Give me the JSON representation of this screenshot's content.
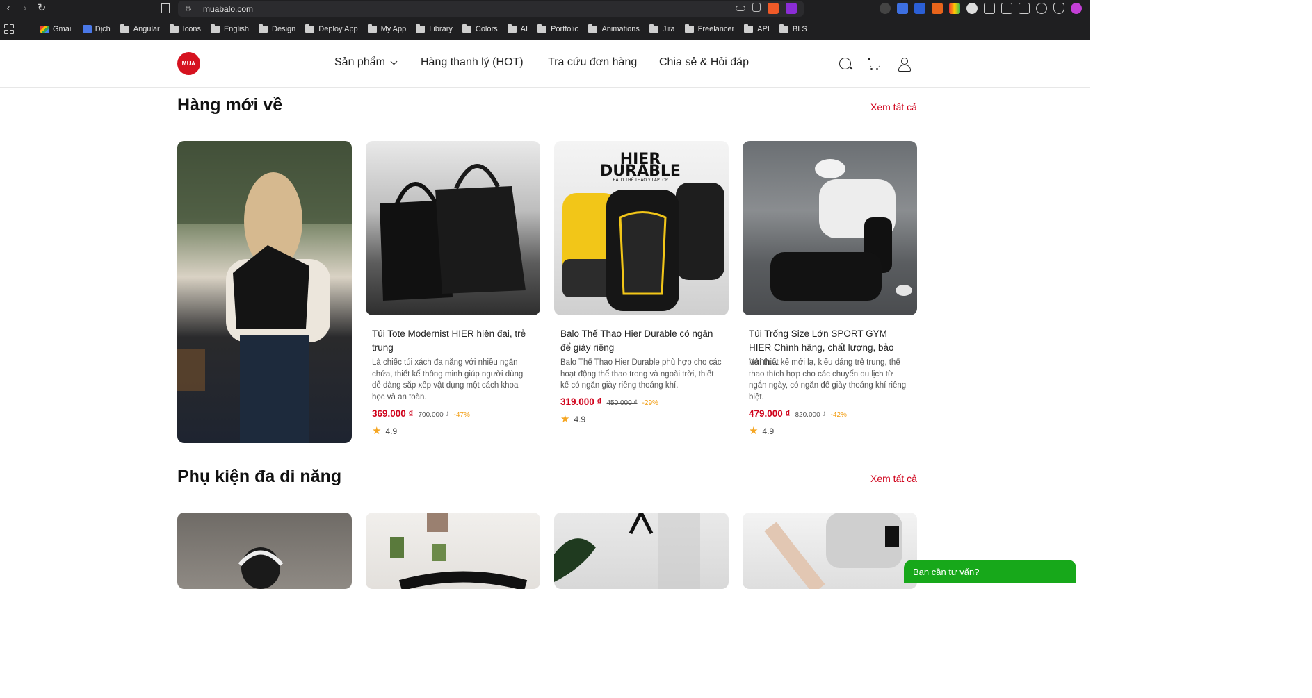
{
  "browser": {
    "url": "muabalo.com",
    "bookmarks": [
      "Gmail",
      "Dịch",
      "Angular",
      "Icons",
      "English",
      "Design",
      "Deploy App",
      "My App",
      "Library",
      "Colors",
      "AI",
      "Portfolio",
      "Animations",
      "Jira",
      "Freelancer",
      "API",
      "BLS"
    ]
  },
  "header": {
    "logo_text": "MUA",
    "nav": {
      "products": "Sản phẩm",
      "clearance": "Hàng thanh lý (HOT)",
      "order_lookup": "Tra cứu đơn hàng",
      "share_qa": "Chia sẻ & Hỏi đáp"
    }
  },
  "new_arrivals": {
    "title": "Hàng mới về",
    "see_all": "Xem tất cả",
    "products": [
      {
        "name": "Túi Tote Modernist HIER hiện đại, trẻ trung",
        "desc": "Là chiếc túi xách đa năng với nhiều ngăn chứa, thiết kế thông minh giúp người dùng dễ dàng sắp xếp vật dụng một cách khoa học và an toàn.",
        "price": "369.000 ₫",
        "old_price": "700.000 ₫",
        "discount": "-47%",
        "rating": "4.9"
      },
      {
        "name": "Balo Thể Thao Hier Durable có ngăn để giày riêng",
        "desc": "Balo Thể Thao Hier Durable phù hợp cho các hoạt động thể thao trong và ngoài trời, thiết kế có ngăn giày riêng thoáng khí.",
        "price": "319.000 ₫",
        "old_price": "450.000 ₫",
        "discount": "-29%",
        "rating": "4.9"
      },
      {
        "name": "Túi Trống Size Lớn SPORT GYM HIER Chính hãng, chất lượng, bảo hành...",
        "desc": "Với thiết kế mới lạ, kiểu dáng trẻ trung, thể thao thích hợp cho các chuyến du lịch từ ngắn ngày, có ngăn để giày thoáng khí riêng biệt.",
        "price": "479.000 ₫",
        "old_price": "820.000 ₫",
        "discount": "-42%",
        "rating": "4.9"
      }
    ],
    "banner_image_text": [
      "HIER",
      "DURABLE",
      "BALO THỂ THAO x LAPTOP"
    ]
  },
  "accessories": {
    "title": "Phụ kiện đa di năng",
    "see_all": "Xem tất cả"
  },
  "chat": {
    "label": "Bạn cần tư vấn?"
  }
}
